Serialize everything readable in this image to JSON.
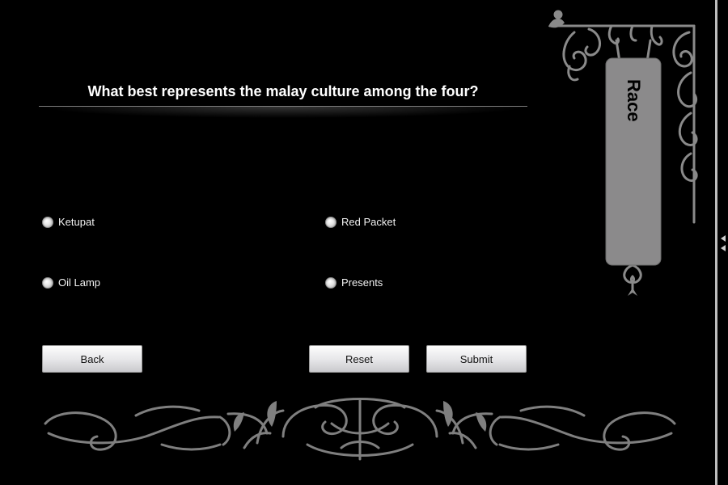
{
  "question": {
    "text": "What best represents the malay culture among the four?"
  },
  "options": [
    {
      "label": "Ketupat",
      "selected": false
    },
    {
      "label": "Red Packet",
      "selected": false
    },
    {
      "label": "Oil Lamp",
      "selected": false
    },
    {
      "label": "Presents",
      "selected": false
    }
  ],
  "buttons": {
    "back": "Back",
    "reset": "Reset",
    "submit": "Submit"
  },
  "sign": {
    "label": "Race"
  },
  "colors": {
    "background": "#000000",
    "ornament": "#8a8a8a",
    "sign_fill": "#8b8a8b",
    "button_top": "#fdfdfd",
    "button_bottom": "#c9c9cd"
  },
  "icons": [
    "radio-button-icon",
    "hanging-sign-ornament",
    "floral-scroll-ornament",
    "collapse-arrows-icon"
  ]
}
